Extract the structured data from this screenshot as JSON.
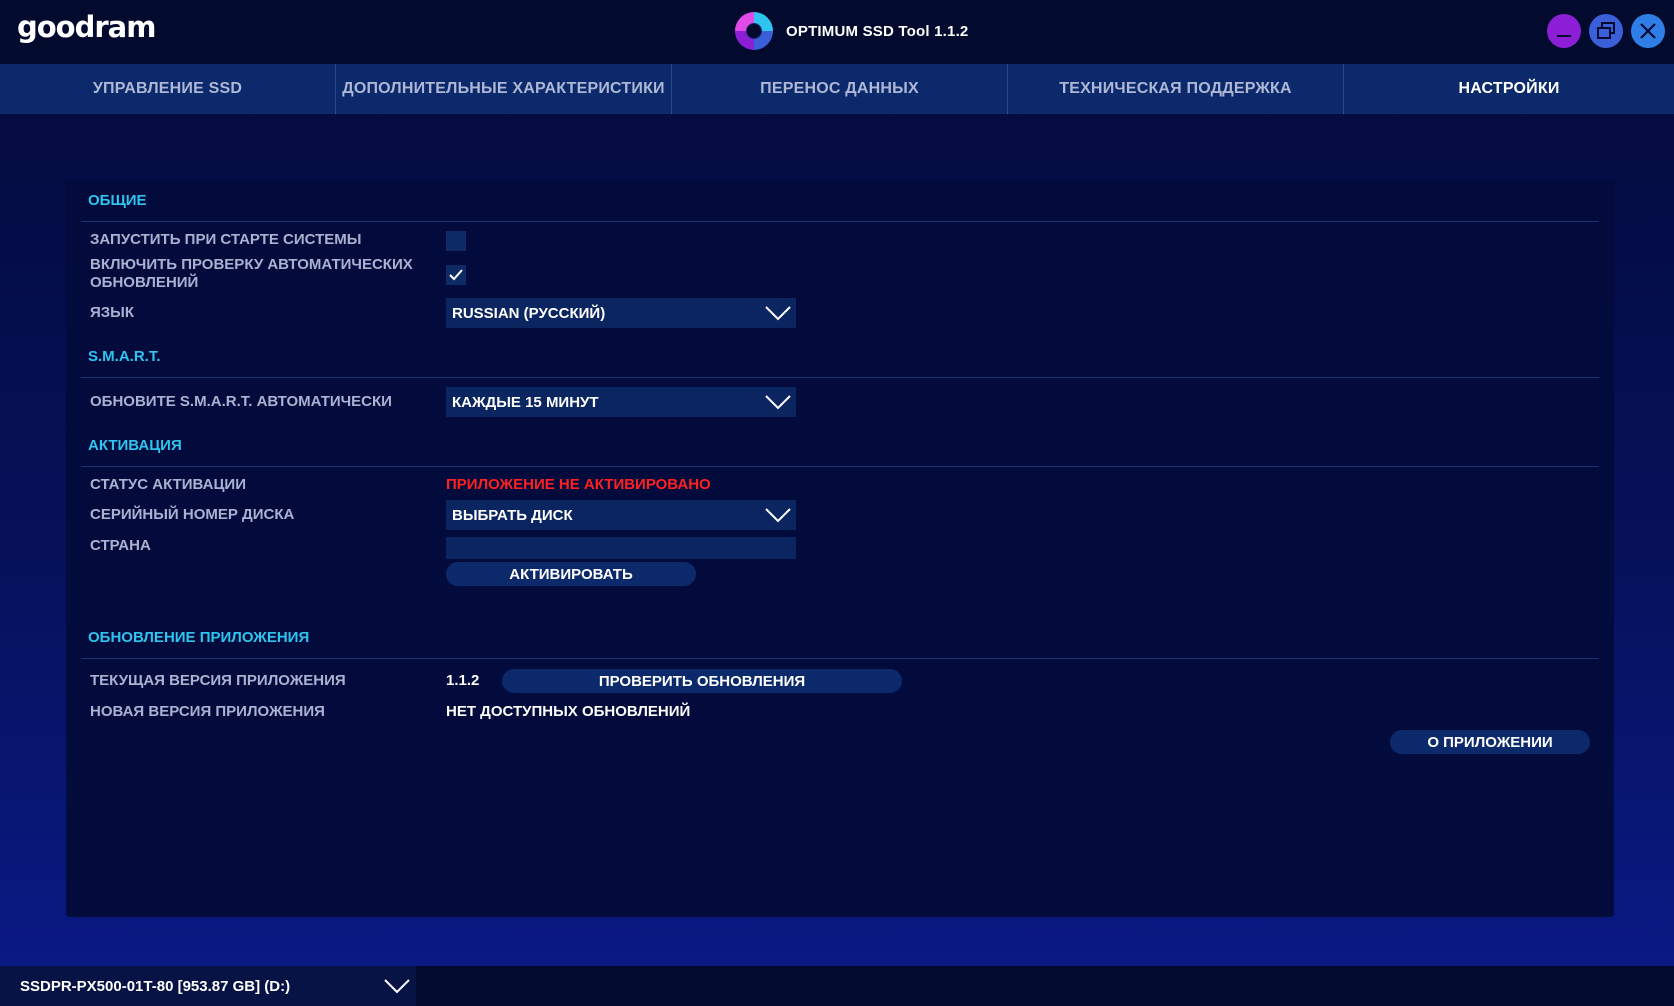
{
  "app": {
    "logo": "goodram",
    "title": "OPTIMUM SSD Tool 1.1.2"
  },
  "window_controls": {
    "minimize_icon": "minimize-icon",
    "restore_icon": "restore-icon",
    "close_icon": "close-icon"
  },
  "tabs": [
    {
      "label": "УПРАВЛЕНИЕ SSD",
      "active": false
    },
    {
      "label": "ДОПОЛНИТЕЛЬНЫЕ ХАРАКТЕРИСТИКИ",
      "active": false
    },
    {
      "label": "ПЕРЕНОС ДАННЫХ",
      "active": false
    },
    {
      "label": "ТЕХНИЧЕСКАЯ ПОДДЕРЖКА",
      "active": false
    },
    {
      "label": "НАСТРОЙКИ",
      "active": true
    }
  ],
  "general": {
    "title": "ОБЩИЕ",
    "autostart_label": "ЗАПУСТИТЬ ПРИ СТАРТЕ СИСТЕМЫ",
    "autostart_checked": false,
    "autoupdate_label_line1": "ВКЛЮЧИТЬ ПРОВЕРКУ АВТОМАТИЧЕСКИХ",
    "autoupdate_label_line2": "ОБНОВЛЕНИЙ",
    "autoupdate_checked": true,
    "language_label": "ЯЗЫК",
    "language_value": "RUSSIAN (РУССКИЙ)"
  },
  "smart": {
    "title": "S.M.A.R.T.",
    "refresh_label": "ОБНОВИТЕ S.M.A.R.T. АВТОМАТИЧЕСКИ",
    "refresh_value": "КАЖДЫЕ 15 МИНУТ"
  },
  "activation": {
    "title": "АКТИВАЦИЯ",
    "status_label": "СТАТУС АКТИВАЦИИ",
    "status_value": "ПРИЛОЖЕНИЕ НЕ АКТИВИРОВАНО",
    "serial_label": "СЕРИЙНЫЙ НОМЕР ДИСКА",
    "serial_value": "ВЫБРАТЬ ДИСК",
    "country_label": "СТРАНА",
    "country_value": "",
    "activate_button": "АКТИВИРОВАТЬ"
  },
  "update": {
    "title": "ОБНОВЛЕНИЕ ПРИЛОЖЕНИЯ",
    "current_label": "ТЕКУЩАЯ ВЕРСИЯ ПРИЛОЖЕНИЯ",
    "current_value": "1.1.2",
    "check_button": "ПРОВЕРИТЬ ОБНОВЛЕНИЯ",
    "new_label": "НОВАЯ ВЕРСИЯ ПРИЛОЖЕНИЯ",
    "new_value": "НЕТ ДОСТУПНЫХ ОБНОВЛЕНИЙ",
    "about_button": "О ПРИЛОЖЕНИИ"
  },
  "disk": {
    "selected": "SSDPR-PX500-01T-80 [953.87 GB] (D:)"
  },
  "colors": {
    "accent": "#2ec4ef",
    "error": "#ff2020",
    "minimize": "#8c1fd6",
    "restore": "#3b5fd9",
    "close": "#2f7ee8"
  }
}
